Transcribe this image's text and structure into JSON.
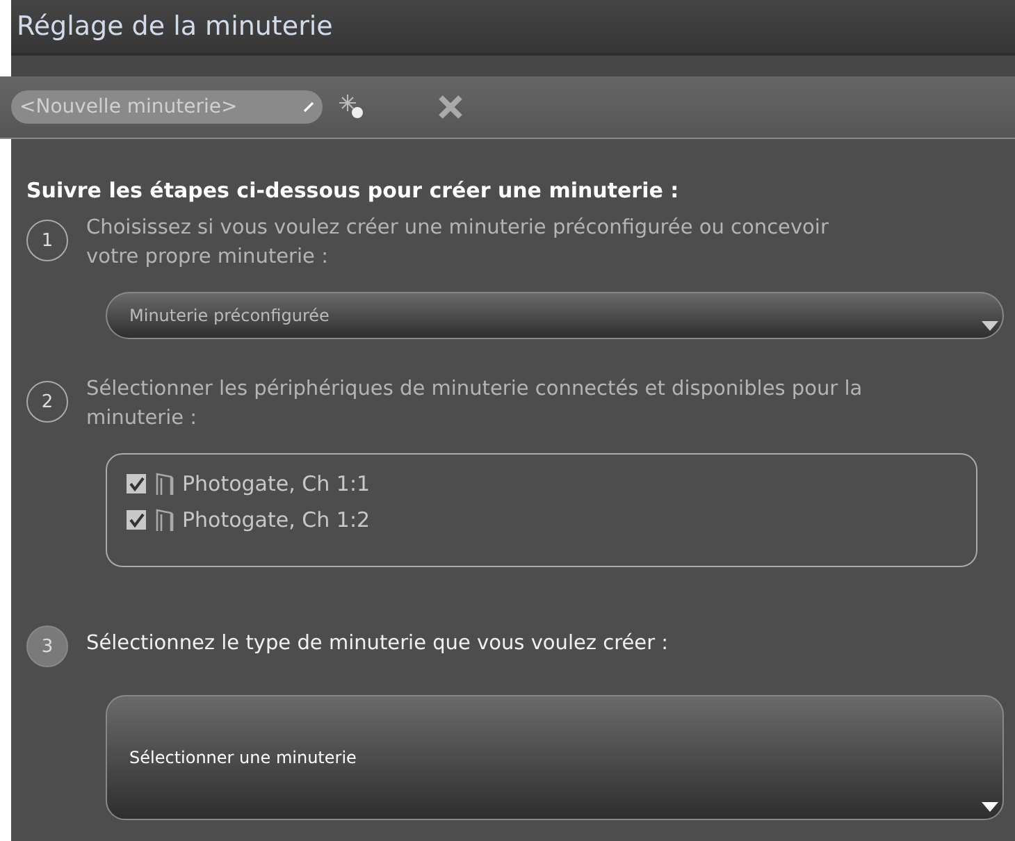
{
  "window": {
    "title": "Réglage de la minuterie"
  },
  "toolbar": {
    "name_field": {
      "value": "<Nouvelle minuterie>"
    }
  },
  "heading": "Suivre les étapes ci-dessous pour créer une minuterie :",
  "steps": [
    {
      "number": "1",
      "active": false,
      "text": "Choisissez si vous voulez créer une minuterie préconfigurée ou concevoir votre propre minuterie :",
      "kind": "dropdown",
      "dropdown": "Minuterie préconfigurée"
    },
    {
      "number": "2",
      "active": false,
      "text": "Sélectionner les périphériques de minuterie connectés et disponibles pour la minuterie :",
      "kind": "checklist",
      "devices": [
        {
          "label": "Photogate, Ch 1:1",
          "checked": true
        },
        {
          "label": "Photogate, Ch 1:2",
          "checked": true
        }
      ]
    },
    {
      "number": "3",
      "active": true,
      "text": "Sélectionnez le type de minuterie que vous voulez créer :",
      "kind": "bigdropdown",
      "dropdown": "Sélectionner une minuterie"
    }
  ]
}
